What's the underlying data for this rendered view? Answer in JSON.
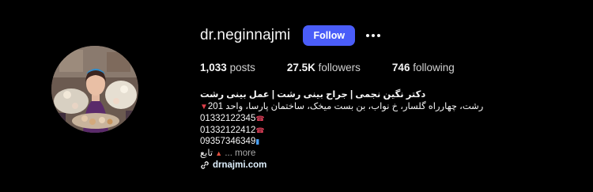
{
  "profile": {
    "username": "dr.neginnajmi",
    "follow_label": "Follow",
    "more_options_icon": "more-horizontal-icon",
    "stats": [
      {
        "value": "1,033",
        "label": "posts"
      },
      {
        "value": "27.5K",
        "label": "followers"
      },
      {
        "value": "746",
        "label": "following"
      }
    ],
    "bio": {
      "name": "دکتر نگین نجمی | جراح بینی رشت | عمل بینی رشت",
      "address": "رشت، چهارراه گلسار، خ نواب، بن بست میخک، ساختمان پارسا، واحد 201",
      "phones": [
        "01332122345",
        "01332122412",
        "09357346349"
      ],
      "follow_text": "تابع",
      "more_label": "... more",
      "link": "drnajmi.com"
    },
    "colors": {
      "background": "#000000",
      "follow_button": "#4a5df9",
      "text": "#f5f5f5",
      "muted": "#a8a8a8"
    }
  }
}
